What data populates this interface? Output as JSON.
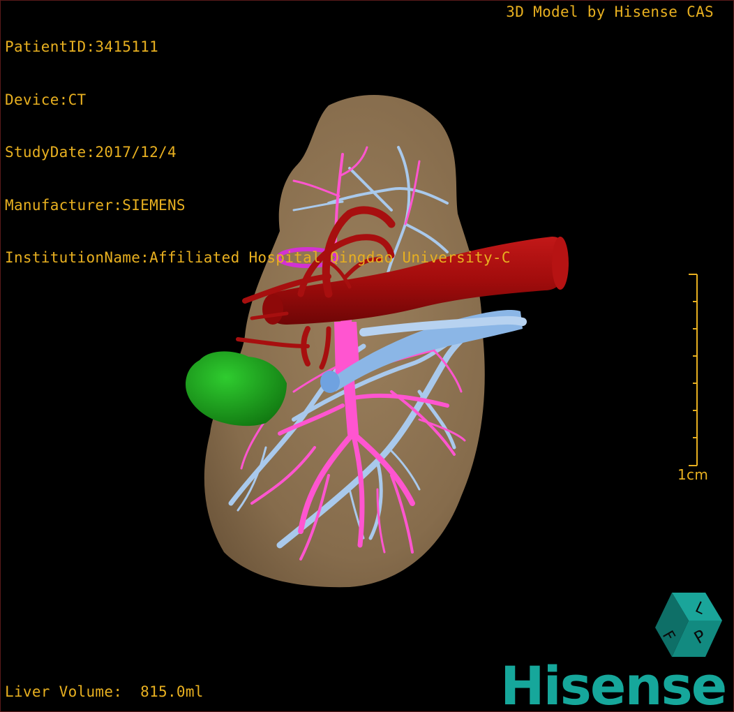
{
  "study_info": {
    "patient_id": "PatientID:3415111",
    "device": "Device:CT",
    "study_date": "StudyDate:2017/12/4",
    "manufacturer": "Manufacturer:SIEMENS",
    "institution": "InstitutionName:Affiliated Hospital Qingdao University-C"
  },
  "model_credit": "3D Model by Hisense CAS",
  "liver_volume": "Liver Volume:  815.0ml",
  "scale_bar": {
    "label": "1cm"
  },
  "orientation_cube": {
    "labels": [
      "L",
      "P",
      "F"
    ]
  },
  "brand": "Hisense",
  "colors": {
    "overlay_text": "#e8b020",
    "liver": "#8e7452",
    "artery": "#a50d0d",
    "portal_vein": "#ff55d0",
    "hepatic_vein": "#9ec4ea",
    "vena_cava_branch": "#6fa2e0",
    "tumor": "#1c9e1c",
    "brand": "#16a79b"
  }
}
